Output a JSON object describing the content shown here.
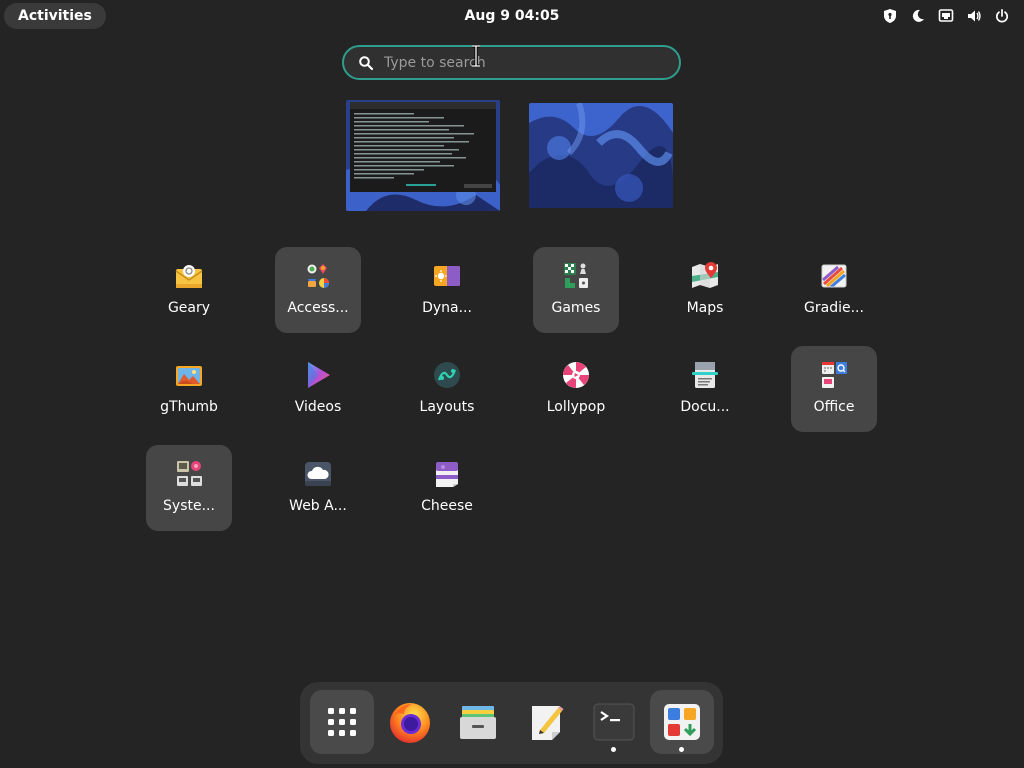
{
  "topbar": {
    "activities_label": "Activities",
    "clock": "Aug 9  04:05",
    "tray_icons": [
      "privacy-shield-icon",
      "night-light-icon",
      "network-wired-icon",
      "volume-icon",
      "power-icon"
    ]
  },
  "search": {
    "placeholder": "Type to search",
    "value": ""
  },
  "workspaces": [
    {
      "name": "workspace-1",
      "content": "terminal-window"
    },
    {
      "name": "workspace-2",
      "content": "empty-desktop"
    }
  ],
  "app_grid": {
    "rows": [
      [
        {
          "label": "Geary",
          "icon": "geary-icon",
          "folder": false
        },
        {
          "label": "Access...",
          "icon": "accessories-folder-icon",
          "folder": true
        },
        {
          "label": "Dyna...",
          "icon": "dynamic-wallpaper-icon",
          "folder": false
        },
        {
          "label": "Games",
          "icon": "games-folder-icon",
          "folder": true
        },
        {
          "label": "Maps",
          "icon": "maps-icon",
          "folder": false
        },
        {
          "label": "Gradie...",
          "icon": "gradience-icon",
          "folder": false
        }
      ],
      [
        {
          "label": "gThumb",
          "icon": "gthumb-icon",
          "folder": false
        },
        {
          "label": "Videos",
          "icon": "videos-icon",
          "folder": false
        },
        {
          "label": "Layouts",
          "icon": "layouts-icon",
          "folder": false
        },
        {
          "label": "Lollypop",
          "icon": "lollypop-icon",
          "folder": false
        },
        {
          "label": "Docu...",
          "icon": "document-scanner-icon",
          "folder": false
        },
        {
          "label": "Office",
          "icon": "office-folder-icon",
          "folder": true
        }
      ],
      [
        {
          "label": "Syste...",
          "icon": "system-folder-icon",
          "folder": true
        },
        {
          "label": "Web A...",
          "icon": "web-apps-icon",
          "folder": false
        },
        {
          "label": "Cheese",
          "icon": "cheese-icon",
          "folder": false
        }
      ]
    ]
  },
  "dock": {
    "items": [
      {
        "name": "show-apps",
        "icon": "app-grid-icon",
        "active": true,
        "running": false
      },
      {
        "name": "firefox",
        "icon": "firefox-icon",
        "active": false,
        "running": false
      },
      {
        "name": "files",
        "icon": "files-icon",
        "active": false,
        "running": false
      },
      {
        "name": "text-editor",
        "icon": "text-editor-icon",
        "active": false,
        "running": false
      },
      {
        "name": "terminal",
        "icon": "terminal-icon",
        "active": false,
        "running": true
      },
      {
        "name": "software",
        "icon": "software-icon",
        "active": true,
        "running": true
      }
    ]
  },
  "colors": {
    "background": "#242424",
    "search_border": "#2e9e8e",
    "folder_tile": "#464646",
    "dock": "#343434"
  }
}
